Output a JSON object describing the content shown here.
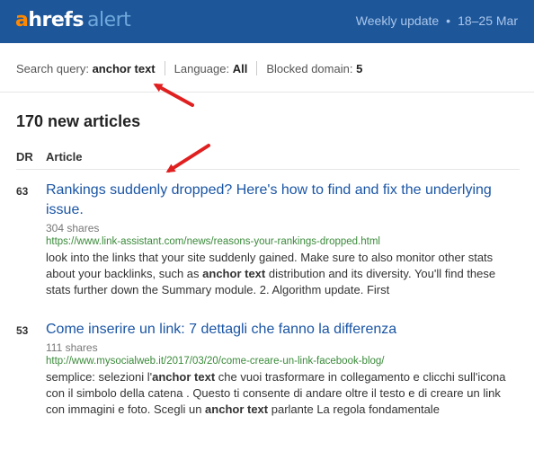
{
  "header": {
    "logo_a": "a",
    "logo_rest": "hrefs",
    "logo_alert": "alert",
    "update_label": "Weekly update",
    "dot": "•",
    "date_range": "18–25 Mar"
  },
  "filters": {
    "query_label": "Search query:",
    "query_value": "anchor text",
    "language_label": "Language:",
    "language_value": "All",
    "blocked_label": "Blocked domain:",
    "blocked_value": "5"
  },
  "summary": {
    "count_text": "170 new articles"
  },
  "table": {
    "col_dr": "DR",
    "col_article": "Article"
  },
  "articles": [
    {
      "dr": "63",
      "title": "Rankings suddenly dropped? Here's how to find and fix the underlying issue.",
      "shares": "304 shares",
      "url": "https://www.link-assistant.com/news/reasons-your-rankings-dropped.html",
      "snippet_part1": "look into the links that your site suddenly gained. Make sure to also monitor other stats about your backlinks, such as ",
      "snippet_bold1": "anchor text",
      "snippet_part2": " distribution and its diversity. You'll find these stats further down the Summary module. 2. Algorithm update. First"
    },
    {
      "dr": "53",
      "title": "Come inserire un link: 7 dettagli che fanno la differenza",
      "shares": "111 shares",
      "url": "http://www.mysocialweb.it/2017/03/20/come-creare-un-link-facebook-blog/",
      "snippet_part1": "semplice: selezioni l'",
      "snippet_bold1": "anchor text",
      "snippet_part2": " che vuoi trasformare in collegamento e clicchi sull'icona con il simbolo della catena . Questo ti consente di andare oltre il testo e di creare un link con immagini e foto. Scegli un ",
      "snippet_bold2": "anchor text",
      "snippet_part3": " parlante La regola fondamentale"
    }
  ],
  "colors": {
    "header_bg": "#1e5799",
    "link": "#1a55a5",
    "url": "#3a8a3a",
    "arrow": "#e02020",
    "logo_a": "#ff8800"
  },
  "annotations": [
    "red-arrow",
    "red-arrow"
  ]
}
